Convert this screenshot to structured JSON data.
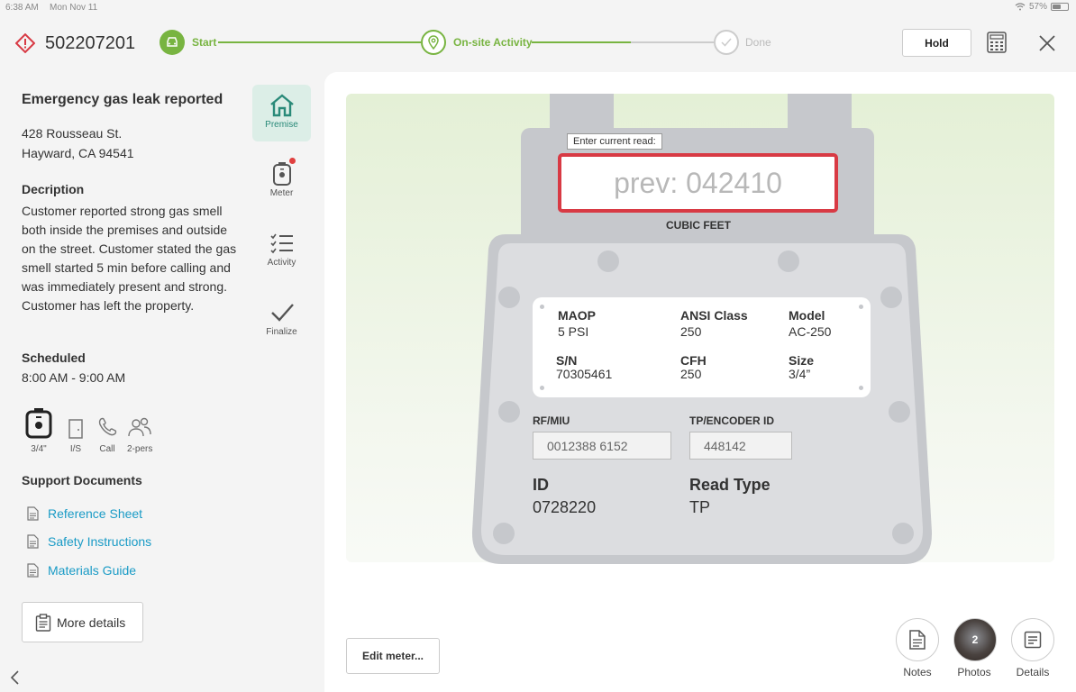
{
  "status_bar": {
    "time": "6:38 AM",
    "date": "Mon Nov 11",
    "battery": "57%",
    "battery_level": 0.57
  },
  "header": {
    "ticket_id": "502207201",
    "steps": [
      {
        "label": "Start",
        "state": "done"
      },
      {
        "label": "On-site Activity",
        "state": "current"
      },
      {
        "label": "Done",
        "state": "pending"
      }
    ],
    "hold_label": "Hold"
  },
  "job": {
    "title": "Emergency gas leak reported",
    "address_line1": "428 Rousseau St.",
    "address_line2": "Hayward, CA 94541",
    "description_heading": "Decription",
    "description": "Customer reported strong gas smell both inside the premises and outside on the street. Customer stated the gas smell started 5 min before calling and was immediately present and strong. Customer has left the property.",
    "scheduled_heading": "Scheduled",
    "scheduled": "8:00 AM - 9:00 AM",
    "attributes": [
      {
        "label": "3/4\"",
        "icon": "meter-icon"
      },
      {
        "label": "I/S",
        "icon": "door-icon"
      },
      {
        "label": "Call",
        "icon": "phone-icon"
      },
      {
        "label": "2-pers",
        "icon": "people-icon"
      }
    ],
    "support_heading": "Support Documents",
    "documents": [
      "Reference Sheet",
      "Safety Instructions",
      "Materials Guide"
    ],
    "more_details": "More details"
  },
  "side_nav": [
    {
      "label": "Premise",
      "icon": "home-icon",
      "active": true
    },
    {
      "label": "Meter",
      "icon": "meter-icon",
      "badge": true
    },
    {
      "label": "Activity",
      "icon": "checklist-icon"
    },
    {
      "label": "Finalize",
      "icon": "checkmark-icon"
    }
  ],
  "meter": {
    "read_prompt": "Enter current read:",
    "read_placeholder": "prev: 042410",
    "unit": "CUBIC FEET",
    "plate": {
      "maop_label": "MAOP",
      "maop": "5 PSI",
      "ansi_label": "ANSI Class",
      "ansi": "250",
      "model_label": "Model",
      "model": "AC-250",
      "sn_label": "S/N",
      "sn": "70305461",
      "cfh_label": "CFH",
      "cfh": "250",
      "size_label": "Size",
      "size": "3/4”"
    },
    "rf_label": "RF/MIU",
    "rf_value": "0012388 6152",
    "tp_label": "TP/ENCODER ID",
    "tp_value": "448142",
    "id_label": "ID",
    "id_value": "0728220",
    "read_type_label": "Read Type",
    "read_type_value": "TP"
  },
  "actions": {
    "edit_meter": "Edit meter...",
    "notes": "Notes",
    "photos": "Photos",
    "photos_count": "2",
    "details": "Details"
  },
  "colors": {
    "accent_green": "#78b441",
    "teal": "#2a8a79",
    "link": "#1a9bc6",
    "alert": "#d83a44"
  }
}
